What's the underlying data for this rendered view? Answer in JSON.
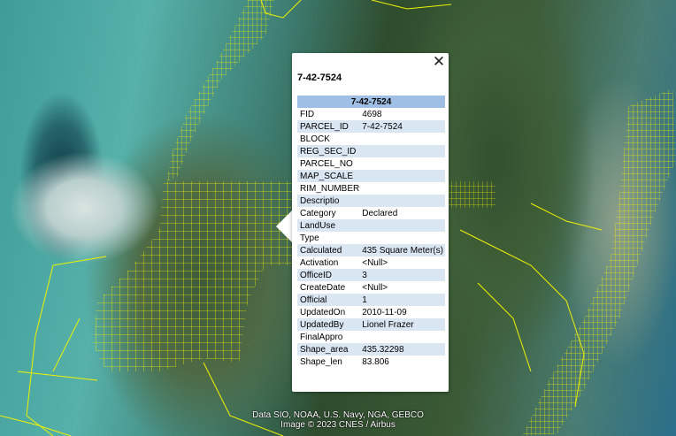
{
  "popup": {
    "close_glyph": "✕",
    "title": "7-42-7524",
    "table_header": "7-42-7524",
    "rows": [
      {
        "key": "FID",
        "value": "4698"
      },
      {
        "key": "PARCEL_ID",
        "value": "7-42-7524"
      },
      {
        "key": "BLOCK",
        "value": ""
      },
      {
        "key": "REG_SEC_ID",
        "value": ""
      },
      {
        "key": "PARCEL_NO",
        "value": ""
      },
      {
        "key": "MAP_SCALE",
        "value": ""
      },
      {
        "key": "RIM_NUMBER",
        "value": ""
      },
      {
        "key": "Descriptio",
        "value": ""
      },
      {
        "key": "Category",
        "value": "Declared"
      },
      {
        "key": "LandUse",
        "value": ""
      },
      {
        "key": "Type",
        "value": ""
      },
      {
        "key": "Calculated",
        "value": "435 Square Meter(s)"
      },
      {
        "key": "Activation",
        "value": "<Null>"
      },
      {
        "key": "OfficeID",
        "value": "3"
      },
      {
        "key": "CreateDate",
        "value": "<Null>"
      },
      {
        "key": "Official",
        "value": "1"
      },
      {
        "key": "UpdatedOn",
        "value": "2010-11-09"
      },
      {
        "key": "UpdatedBy",
        "value": "Lionel Frazer"
      },
      {
        "key": "FinalAppro",
        "value": ""
      },
      {
        "key": "Shape_area",
        "value": "435.32298"
      },
      {
        "key": "Shape_len",
        "value": "83.806"
      }
    ]
  },
  "attribution": {
    "line1": "Data SIO, NOAA, U.S. Navy, NGA, GEBCO",
    "line2": "Image © 2023 CNES / Airbus"
  },
  "colors": {
    "parcel_outline": "#f2f200",
    "header_bg": "#9fbfe5",
    "alt_row_bg": "#dbe6f3"
  }
}
